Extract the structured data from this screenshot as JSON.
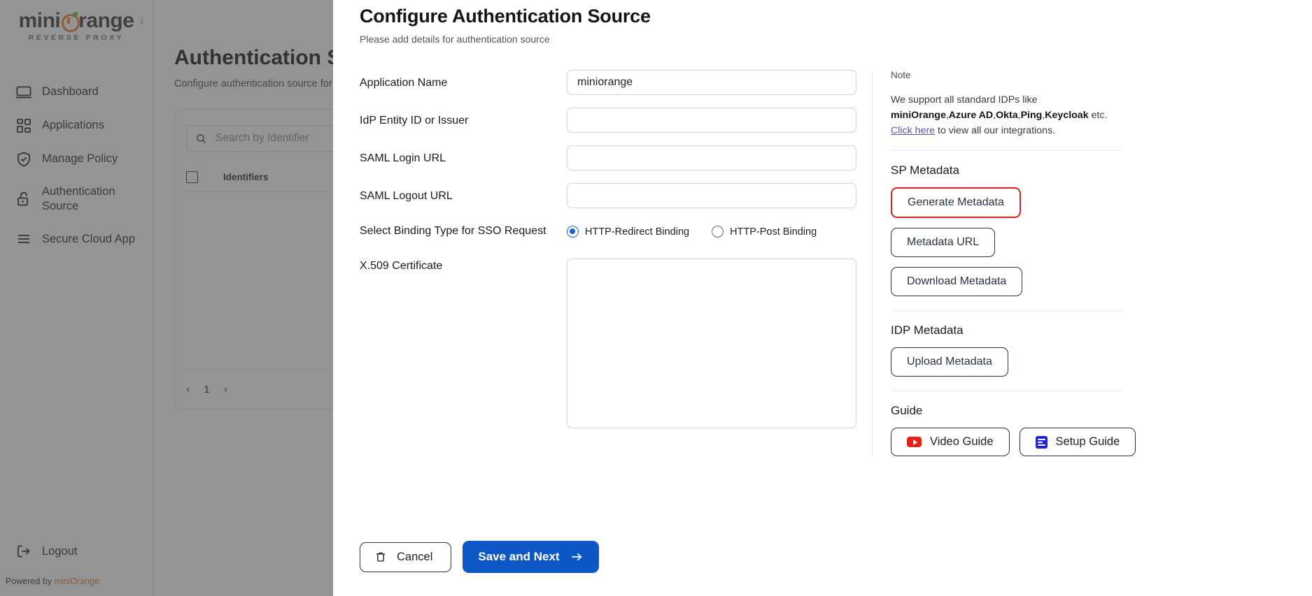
{
  "brand": {
    "name_part1": "mini",
    "name_part2": "range",
    "tagline": "REVERSE PROXY",
    "accent": "#f07c28"
  },
  "sidebar": {
    "items": [
      {
        "label": "Dashboard",
        "icon": "monitor-icon"
      },
      {
        "label": "Applications",
        "icon": "grid-icon"
      },
      {
        "label": "Manage Policy",
        "icon": "shield-check-icon"
      },
      {
        "label": "Authentication Source",
        "icon": "unlock-icon"
      },
      {
        "label": "Secure Cloud App",
        "icon": "list-icon"
      }
    ],
    "logout": "Logout",
    "powered_prefix": "Powered by ",
    "powered_brand": "miniOrange"
  },
  "background_page": {
    "title": "Authentication Source",
    "subtitle": "Configure authentication source for your application",
    "search_placeholder": "Search by Identifier",
    "table_header": "Identifiers",
    "pagination": {
      "page": "1",
      "prev": "‹",
      "next": "›"
    }
  },
  "modal": {
    "title": "Configure Authentication Source",
    "subtitle": "Please add details for authentication source",
    "fields": [
      {
        "label": "Application Name",
        "value": "miniorange",
        "placeholder": ""
      },
      {
        "label": "IdP Entity ID or Issuer",
        "value": "",
        "placeholder": ""
      },
      {
        "label": "SAML Login URL",
        "value": "",
        "placeholder": ""
      },
      {
        "label": "SAML Logout URL",
        "value": "",
        "placeholder": ""
      }
    ],
    "binding": {
      "label": "Select Binding Type for SSO Request",
      "options": [
        {
          "label": "HTTP-Redirect Binding",
          "selected": true
        },
        {
          "label": "HTTP-Post Binding",
          "selected": false
        }
      ],
      "accent": "#1565d8"
    },
    "certificate": {
      "label": "X.509 Certificate",
      "value": "",
      "placeholder": ""
    },
    "footer": {
      "cancel_label": "Cancel",
      "cancel_icon": "trash-icon",
      "save_label": "Save and Next",
      "save_icon": "arrow-right-icon",
      "save_color": "#0d58c6"
    }
  },
  "note_panel": {
    "note_title": "Note",
    "note_line_a": "We support all standard IDPs like ",
    "note_bold_a": "miniOrange",
    "note_comma1": ",",
    "note_bold_b": "Azure AD",
    "note_comma2": ",",
    "note_bold_c": "Okta",
    "note_comma3": ",",
    "note_bold_d": "Ping",
    "note_comma4": ",",
    "note_bold_e": "Keycloak",
    "note_line_b": " etc. ",
    "note_link": "Click here",
    "note_line_c": " to view all our integrations.",
    "sp_metadata": {
      "title": "SP Metadata",
      "buttons": [
        {
          "label": "Generate Metadata",
          "highlighted": true,
          "highlight_color": "#e02020"
        },
        {
          "label": "Metadata URL",
          "highlighted": false
        },
        {
          "label": "Download Metadata",
          "highlighted": false
        }
      ]
    },
    "idp_metadata": {
      "title": "IDP Metadata",
      "buttons": [
        {
          "label": "Upload Metadata",
          "highlighted": false
        }
      ]
    },
    "guide": {
      "title": "Guide",
      "buttons": [
        {
          "label": "Video Guide",
          "icon": "youtube-icon"
        },
        {
          "label": "Setup Guide",
          "icon": "document-icon"
        }
      ]
    }
  }
}
